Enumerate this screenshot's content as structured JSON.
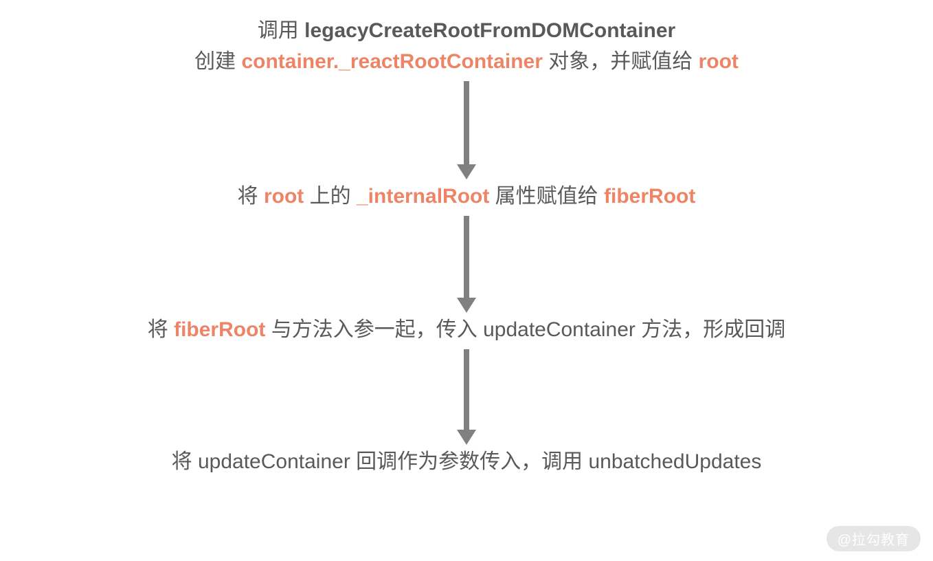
{
  "steps": {
    "s1": {
      "line1_a": "调用 ",
      "line1_b": "legacyCreateRootFromDOMContainer",
      "line2_a": "创建 ",
      "line2_hl1": "container._reactRootContainer",
      "line2_b": " 对象，并赋值给 ",
      "line2_hl2": "root"
    },
    "s2": {
      "a": "将 ",
      "hl1": "root",
      "b": " 上的 ",
      "hl2": "_internalRoot",
      "c": " 属性赋值给 ",
      "hl3": "fiberRoot"
    },
    "s3": {
      "a": "将 ",
      "hl1": "fiberRoot",
      "b": " 与方法入参一起，传入 updateContainer 方法，形成回调"
    },
    "s4": {
      "text": "将 updateContainer 回调作为参数传入，调用 unbatchedUpdates"
    }
  },
  "arrow_heights": {
    "h1": "122",
    "h2": "120",
    "h3": "118"
  },
  "watermark": "@拉勾教育"
}
